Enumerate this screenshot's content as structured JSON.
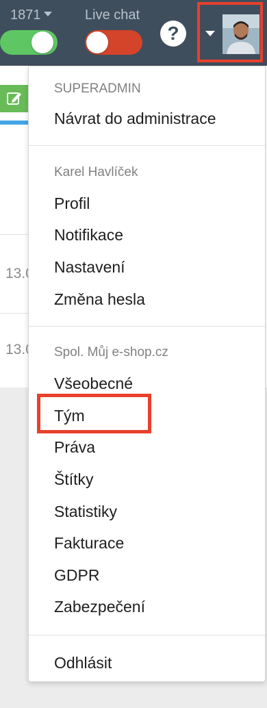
{
  "topbar": {
    "toggle1_label": "1871",
    "toggle2_label": "Live chat",
    "help_glyph": "?",
    "colors": {
      "bar": "#3f4e5c",
      "toggle_on": "#5ec764",
      "toggle_off": "#d4442a",
      "highlight": "#e8402d"
    }
  },
  "page": {
    "row_dates": [
      "13.0",
      "13.0"
    ]
  },
  "dropdown": {
    "section1": {
      "header": "SUPERADMIN",
      "items": [
        "Návrat do administrace"
      ]
    },
    "section2": {
      "header": "Karel Havlíček",
      "items": [
        "Profil",
        "Notifikace",
        "Nastavení",
        "Změna hesla"
      ]
    },
    "section3": {
      "header": "Spol. Můj e-shop.cz",
      "items": [
        "Všeobecné",
        "Tým",
        "Práva",
        "Štítky",
        "Statistiky",
        "Fakturace",
        "GDPR",
        "Zabezpečení"
      ]
    },
    "section4": {
      "items": [
        "Odhlásit"
      ]
    }
  },
  "icons": {
    "help": "question-circle-icon",
    "caret": "caret-down-icon",
    "edit": "pencil-square-icon",
    "avatar": "user-avatar"
  }
}
